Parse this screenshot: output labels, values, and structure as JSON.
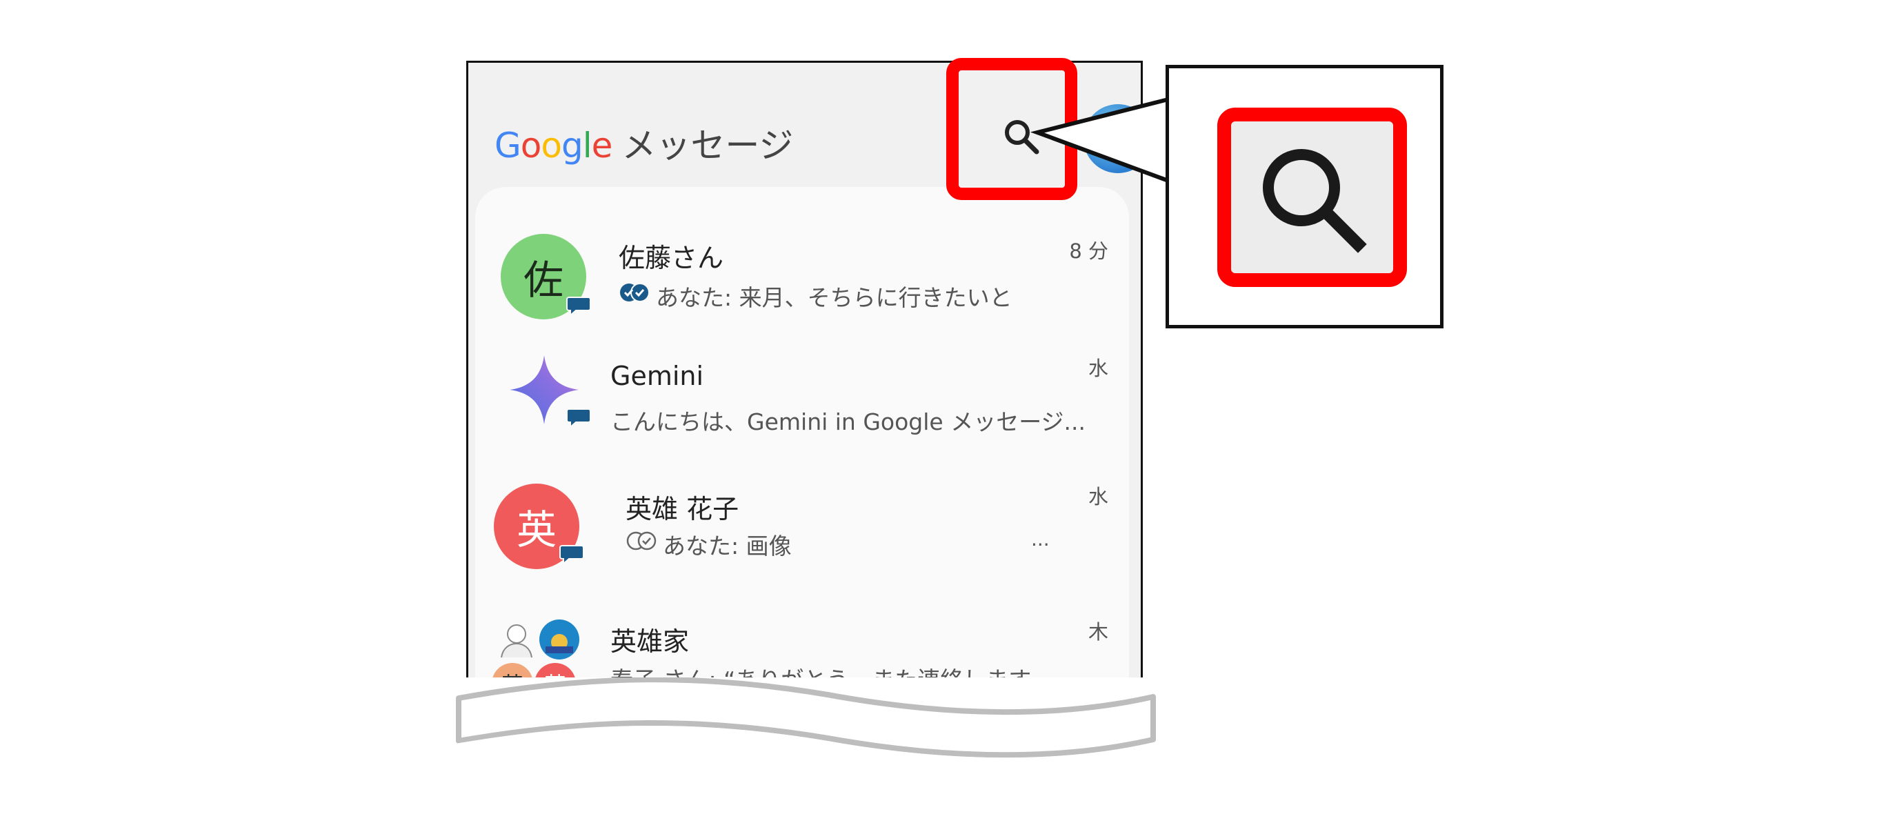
{
  "app": {
    "brand_letters": [
      "G",
      "o",
      "o",
      "g",
      "l",
      "e"
    ],
    "brand_colors": [
      "#4285F4",
      "#EA4335",
      "#FBBC05",
      "#4285F4",
      "#34A853",
      "#EA4335"
    ],
    "title": "メッセージ"
  },
  "conversations": [
    {
      "name": "佐藤さん",
      "avatar_text": "佐",
      "avatar_color": "#7dd27a",
      "snippet": "あなた: 来月、そちらに行きたいと",
      "read_icon": "double-check-filled-icon",
      "time": "8 分"
    },
    {
      "name": "Gemini",
      "avatar_icon": "gemini-sparkle-icon",
      "snippet": "こんにちは、Gemini in Google メッセージ...",
      "time": "水"
    },
    {
      "name": "英雄 花子",
      "avatar_text": "英",
      "avatar_color": "#f05a5a",
      "snippet": "あなた: 画像",
      "read_icon": "double-check-outline-icon",
      "ellipsis": "...",
      "time": "水"
    },
    {
      "name": "英雄家",
      "avatar_icon": "group-avatar-icon",
      "group_avatar_texts": [
        "英",
        "英"
      ],
      "snippet": "春子 さん: “ありがとう、また連絡します...",
      "time": "木"
    }
  ],
  "colors": {
    "highlight": "#ff0000",
    "badge": "#1a5a8a",
    "callout_bg": "#ececec"
  }
}
